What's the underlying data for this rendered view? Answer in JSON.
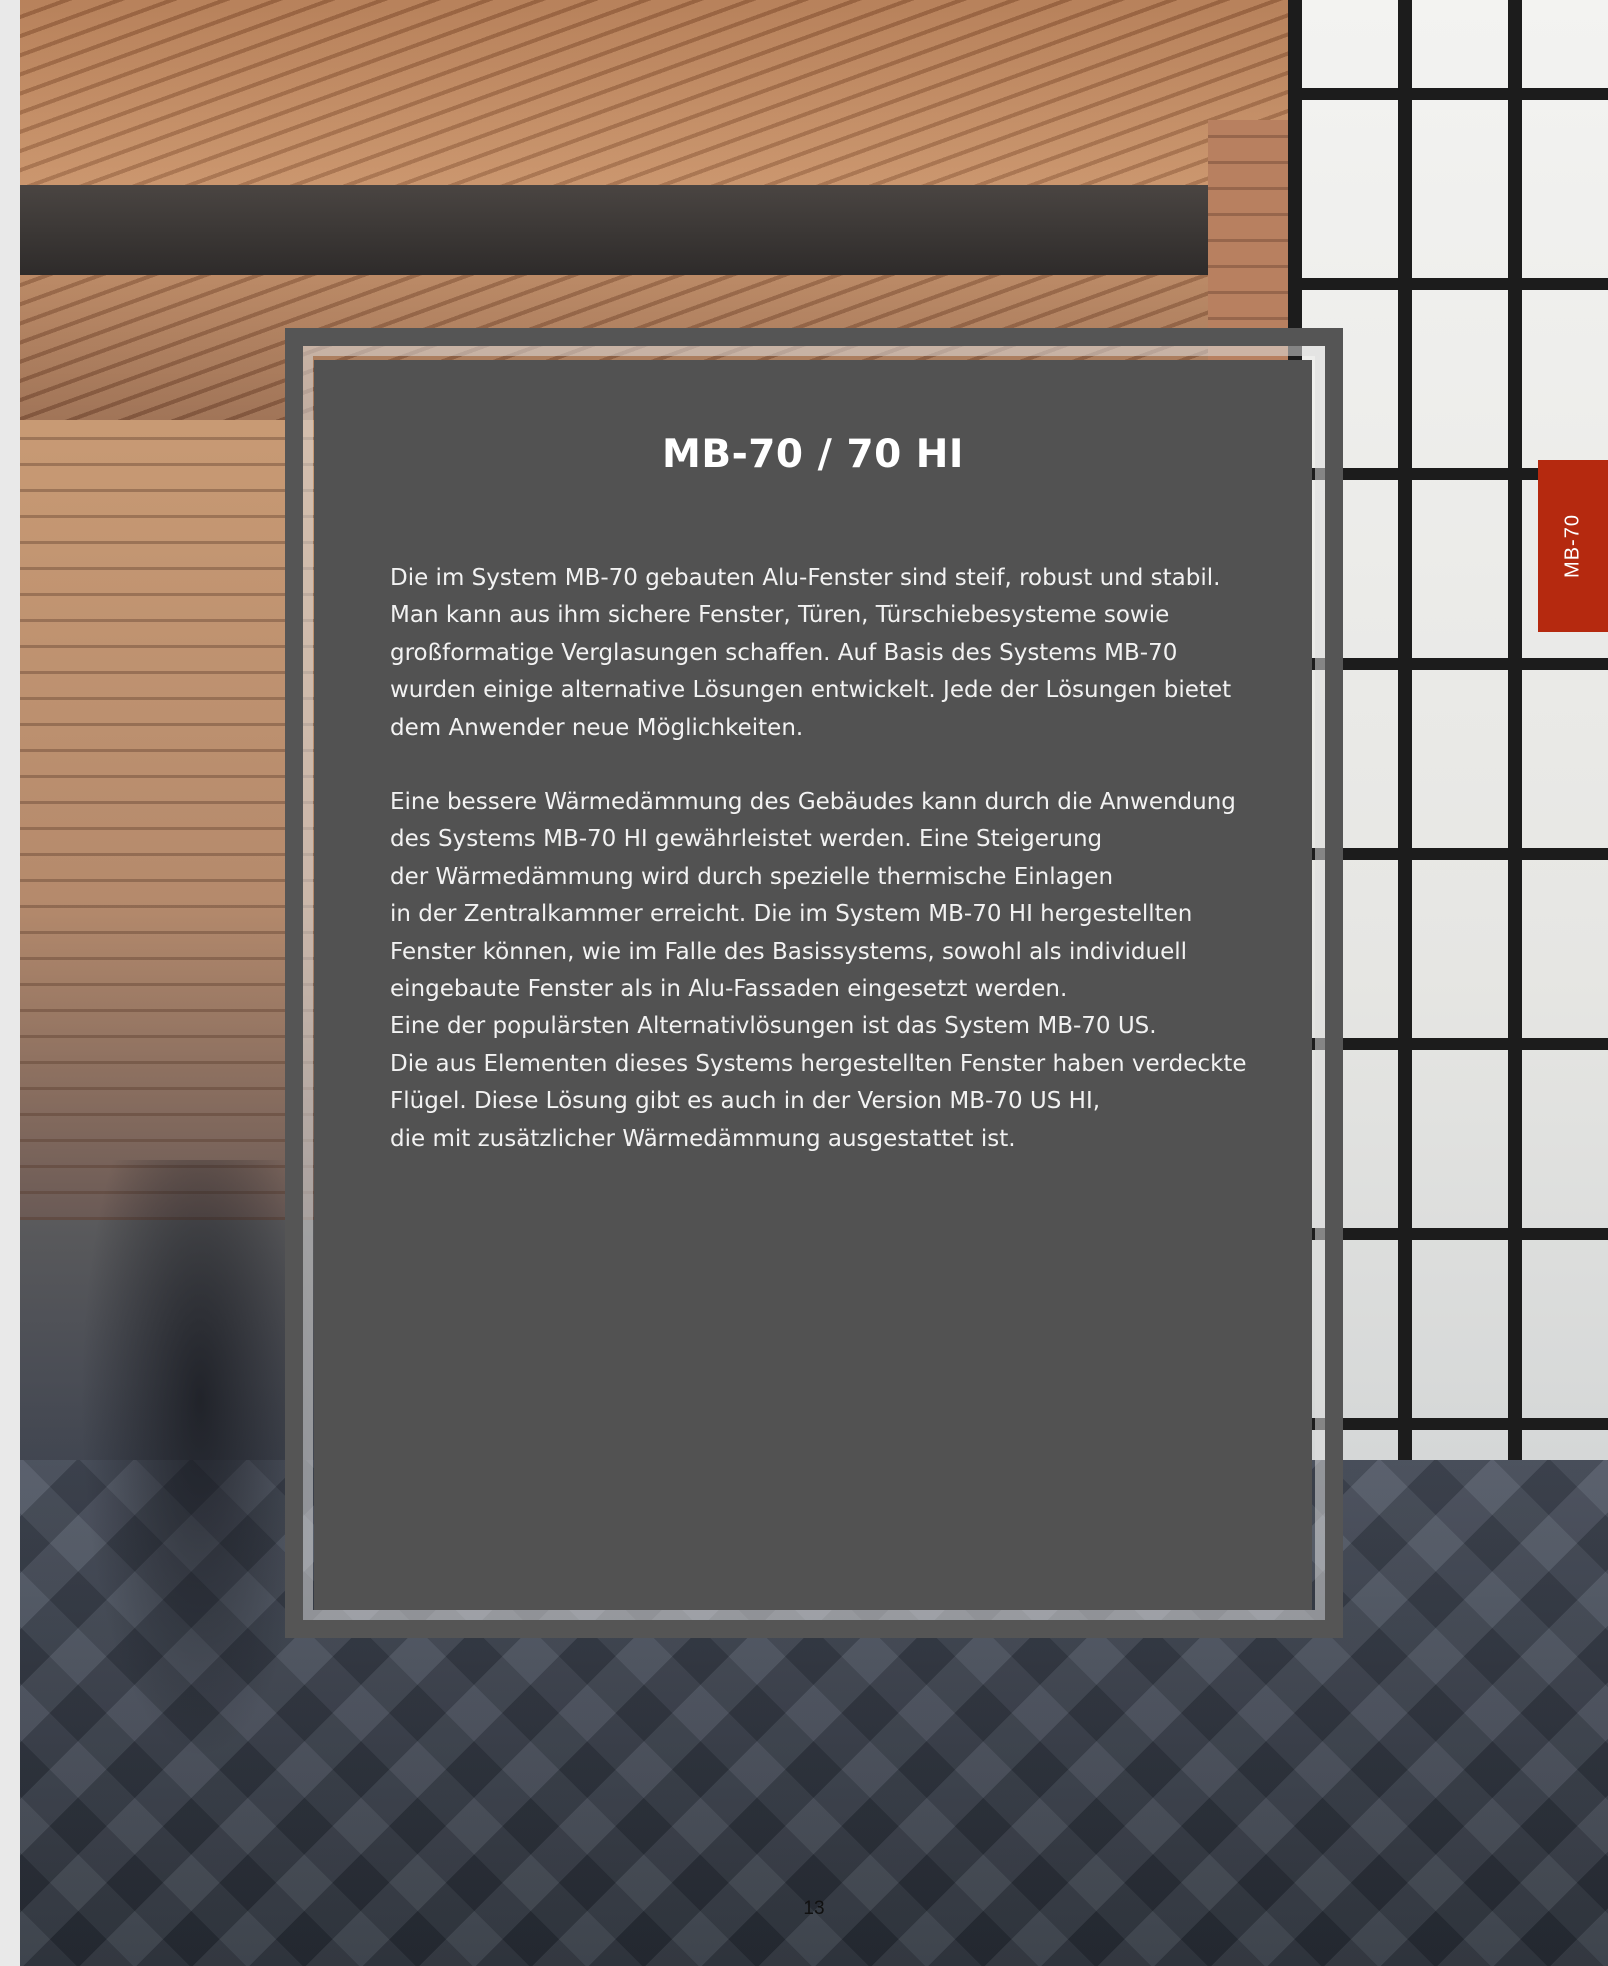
{
  "colors": {
    "panel": "#525252",
    "frame": "#555555",
    "tab_accent": "#b5290f",
    "text": "#ffffff"
  },
  "panel": {
    "title": "MB-70 / 70 HI",
    "paragraph1": [
      "Die im System MB-70 gebauten Alu-Fenster sind steif, robust und stabil.",
      "Man kann aus ihm sichere Fenster, Türen, Türschiebesysteme sowie",
      "großformatige Verglasungen schaffen. Auf Basis des Systems MB-70",
      "wurden einige alternative Lösungen entwickelt. Jede der Lösungen bietet",
      "dem Anwender neue Möglichkeiten."
    ],
    "paragraph2": [
      "Eine bessere Wärmedämmung des Gebäudes kann durch die Anwendung",
      "des Systems MB-70 HI gewährleistet werden. Eine Steigerung",
      "der Wärmedämmung wird durch spezielle thermische Einlagen",
      "in der Zentralkammer erreicht. Die im System MB-70 HI hergestellten",
      "Fenster können, wie im Falle des Basissystems, sowohl als individuell",
      "eingebaute Fenster als in Alu-Fassaden eingesetzt werden.",
      "Eine der populärsten Alternativlösungen ist das System MB-70 US.",
      "Die aus Elementen dieses Systems hergestellten Fenster haben verdeckte",
      "Flügel. Diese Lösung gibt es auch in der Version MB-70 US HI,",
      "die mit zusätzlicher Wärmedämmung ausgestattet ist."
    ]
  },
  "side_tab": {
    "label": "MB-70"
  },
  "page_number": "13"
}
